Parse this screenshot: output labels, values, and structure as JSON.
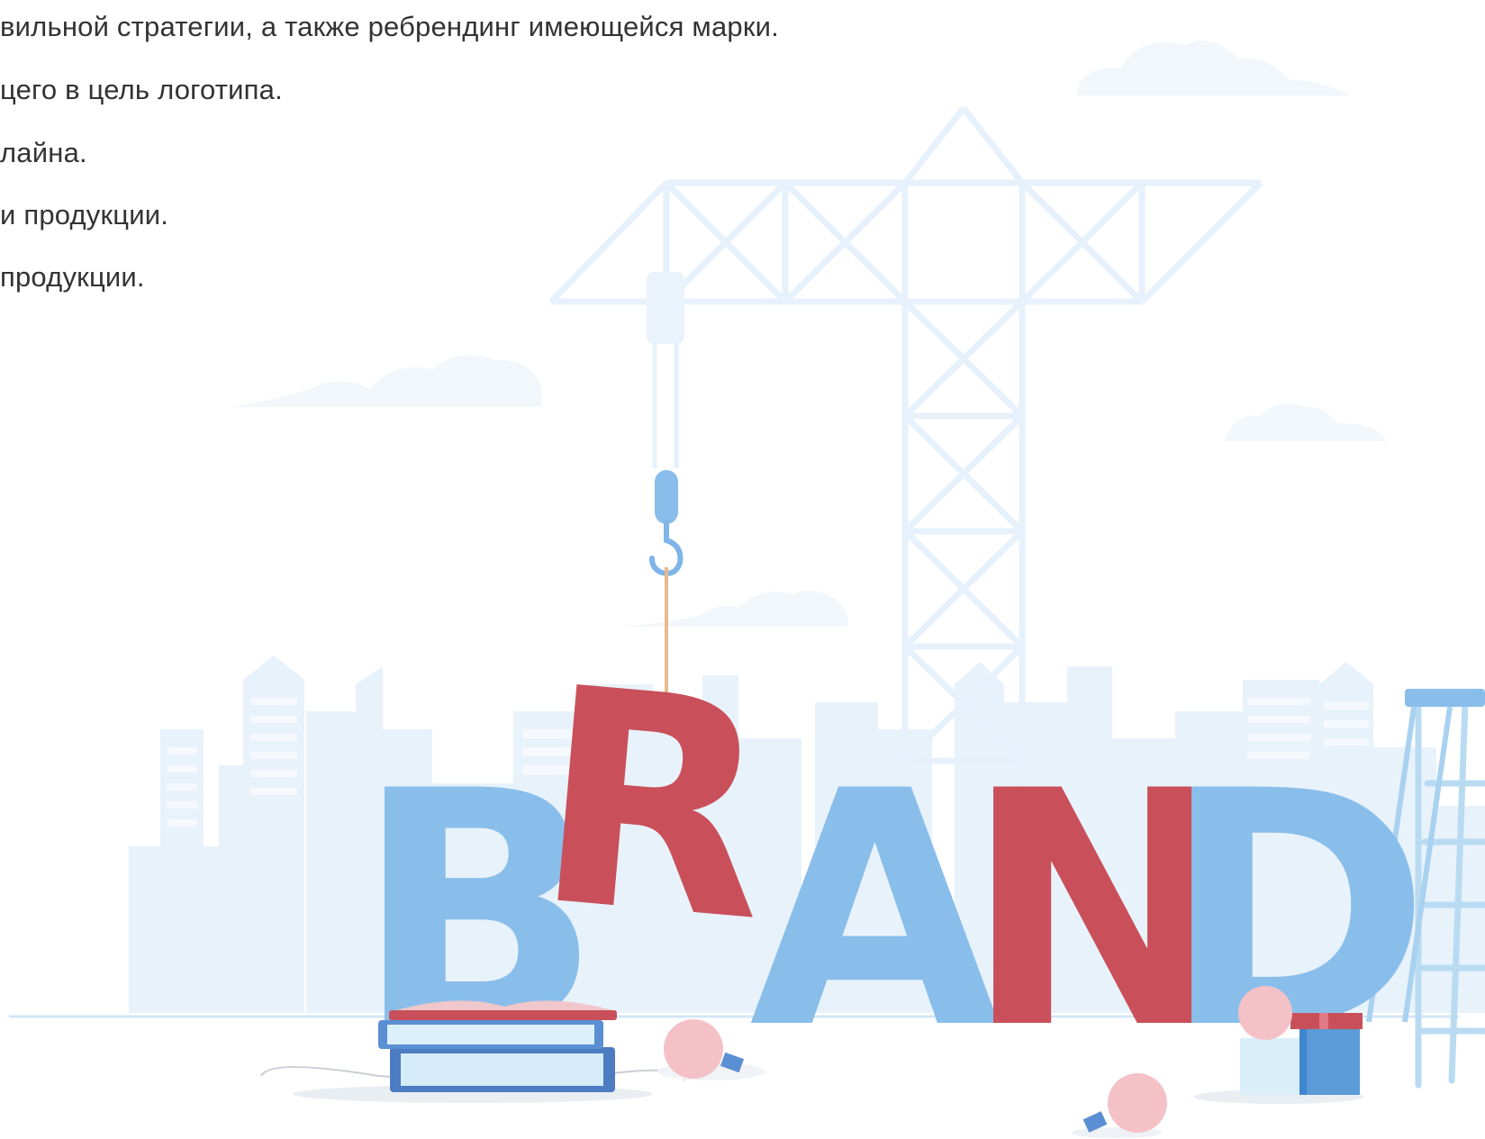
{
  "text_lines": [
    "вильной стратегии, а также ребрендинг имеющейся марки.",
    "цего в цель логотипа.",
    "лайна.",
    "и продукции.",
    "продукции."
  ],
  "illustration": {
    "word": [
      "B",
      "R",
      "A",
      "N",
      "D"
    ],
    "colors": {
      "blue_letter": "#89BEEB",
      "red_letter": "#C9505A",
      "crane": "#E6F1FB",
      "city": "#E8F2FB",
      "cloud": "#F1F7FC",
      "hook": "#7FB5E8",
      "rope": "#E9B98F",
      "ground": "#D3E6F6"
    }
  }
}
